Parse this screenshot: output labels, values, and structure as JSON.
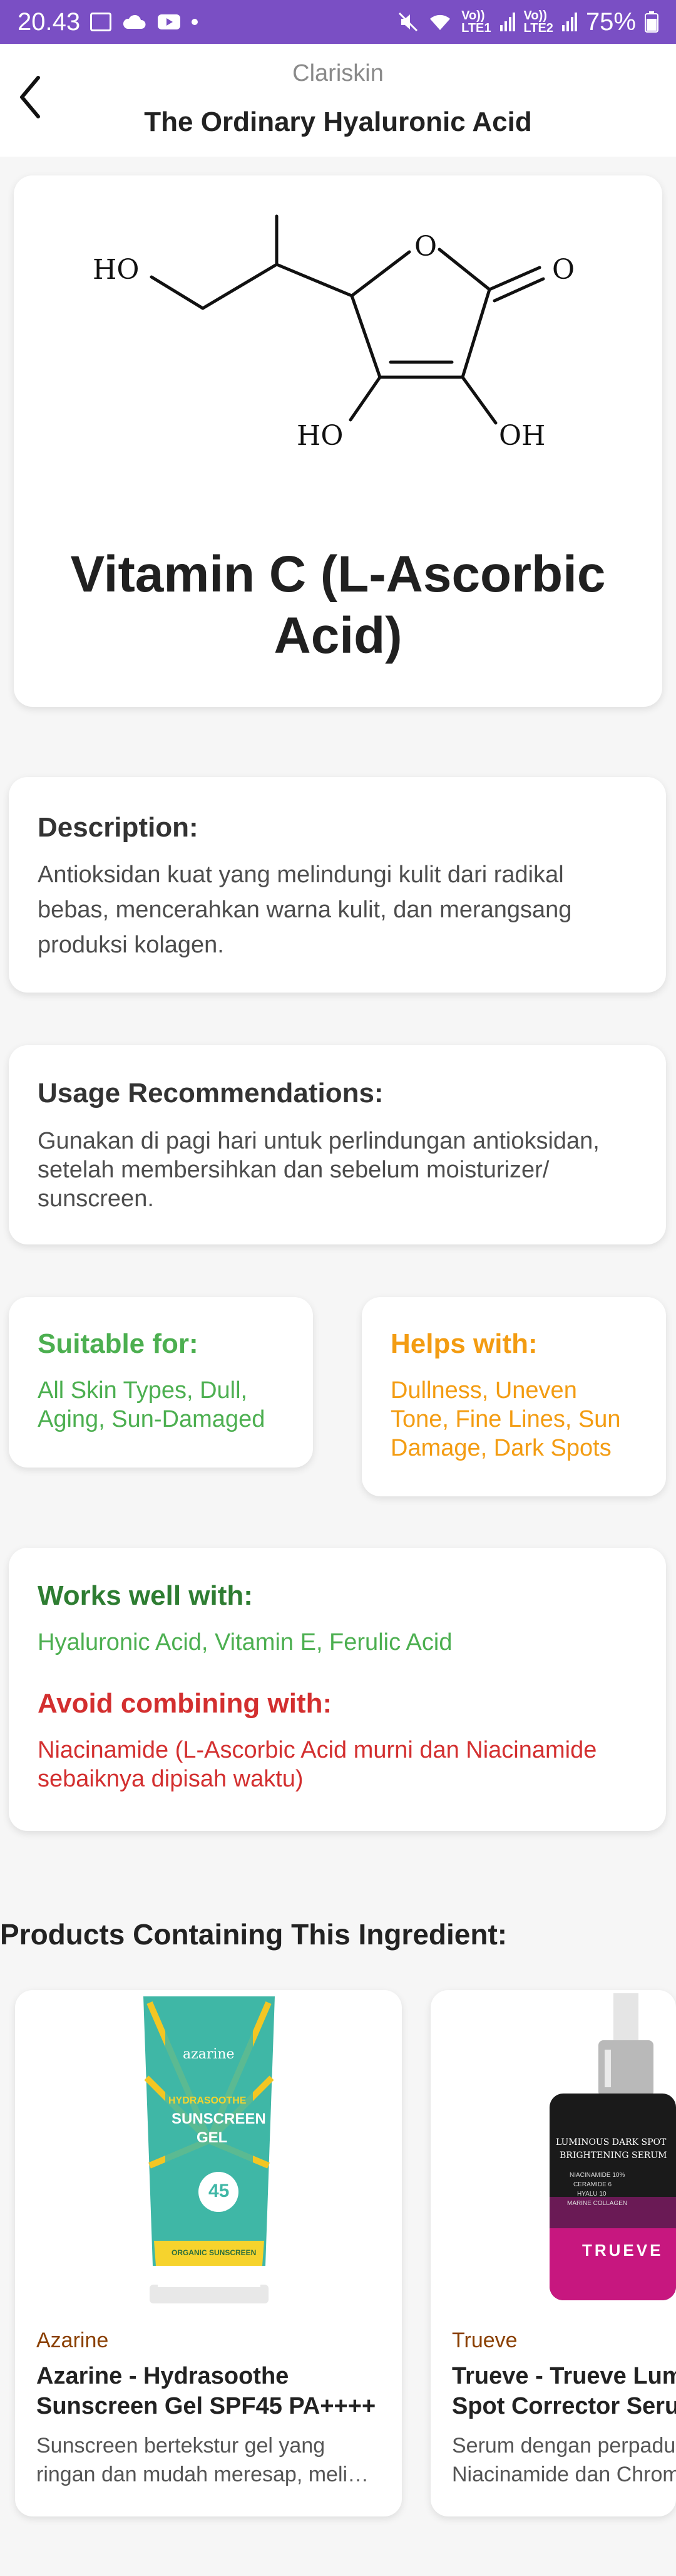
{
  "status_bar": {
    "time": "20.43",
    "sim1": "Vo))\nLTE1",
    "sim2": "Vo))\nLTE2",
    "battery": "75%"
  },
  "header": {
    "brand": "Clariskin",
    "title": "The Ordinary Hyaluronic Acid"
  },
  "ingredient": {
    "name": "Vitamin C (L-Ascorbic Acid)",
    "structure_labels": {
      "ho_left": "HO",
      "o_ring": "O",
      "o_carbonyl": "O",
      "ho_bottom": "HO",
      "oh_bottom": "OH"
    }
  },
  "description": {
    "heading": "Description:",
    "text": "Antioksidan kuat yang melindungi kulit dari radikal bebas, mencerahkan warna kulit, dan merangsang produksi kolagen."
  },
  "usage": {
    "heading": "Usage Recommendations:",
    "text": "Gunakan di pagi hari untuk perlindungan antioksidan, setelah membersihkan dan sebelum moisturizer/ sunscreen."
  },
  "suitable": {
    "heading": "Suitable for:",
    "text": "All Skin Types, Dull, Aging, Sun-Damaged"
  },
  "helps": {
    "heading": "Helps with:",
    "text": "Dullness, Uneven Tone, Fine Lines, Sun Damage, Dark Spots"
  },
  "combinations": {
    "works_heading": "Works well with:",
    "works_text": "Hyaluronic Acid, Vitamin E, Ferulic Acid",
    "avoid_heading": "Avoid combining with:",
    "avoid_text": "Niacinamide (L-Ascorbic Acid murni dan Niacinamide sebaiknya dipisah waktu)"
  },
  "products": {
    "heading": "Products Containing This Ingredient:",
    "items": [
      {
        "brand": "Azarine",
        "name_line1": "Azarine - Hydrasoothe",
        "name_line2": "Sunscreen Gel SPF45 PA++++",
        "desc_line1": "Sunscreen bertekstur gel yang",
        "desc_line2": "ringan dan mudah meresap, melin...",
        "image_text": {
          "logo": "azarine",
          "line1": "HYDRASOOTHE",
          "line2": "SUNSCREEN",
          "line3": "GEL",
          "spf": "45",
          "bottom": "ORGANIC SUNSCREEN"
        }
      },
      {
        "brand": "Trueve",
        "name_line1": "Trueve - Trueve Lum",
        "name_line2": "Spot Corrector Serum",
        "desc_line1": "Serum dengan perpadu",
        "desc_line2": "Niacinamide dan Chrom",
        "image_text": {
          "line1": "LUMINOUS DARK SPOT",
          "line2": "BRIGHTENING SERUM",
          "ing1": "NIACINAMIDE 10%",
          "ing2": "CERAMIDE 6",
          "ing3": "HYALU 10",
          "ing4": "MARINE COLLAGEN",
          "logo": "TRUEVE"
        }
      }
    ]
  },
  "colors": {
    "status_bar": "#7a4fc4",
    "green": "#4caf50",
    "dark_green": "#2e7d32",
    "orange": "#f39c12",
    "red": "#d32f2f",
    "brand_brown": "#8a3f00"
  }
}
